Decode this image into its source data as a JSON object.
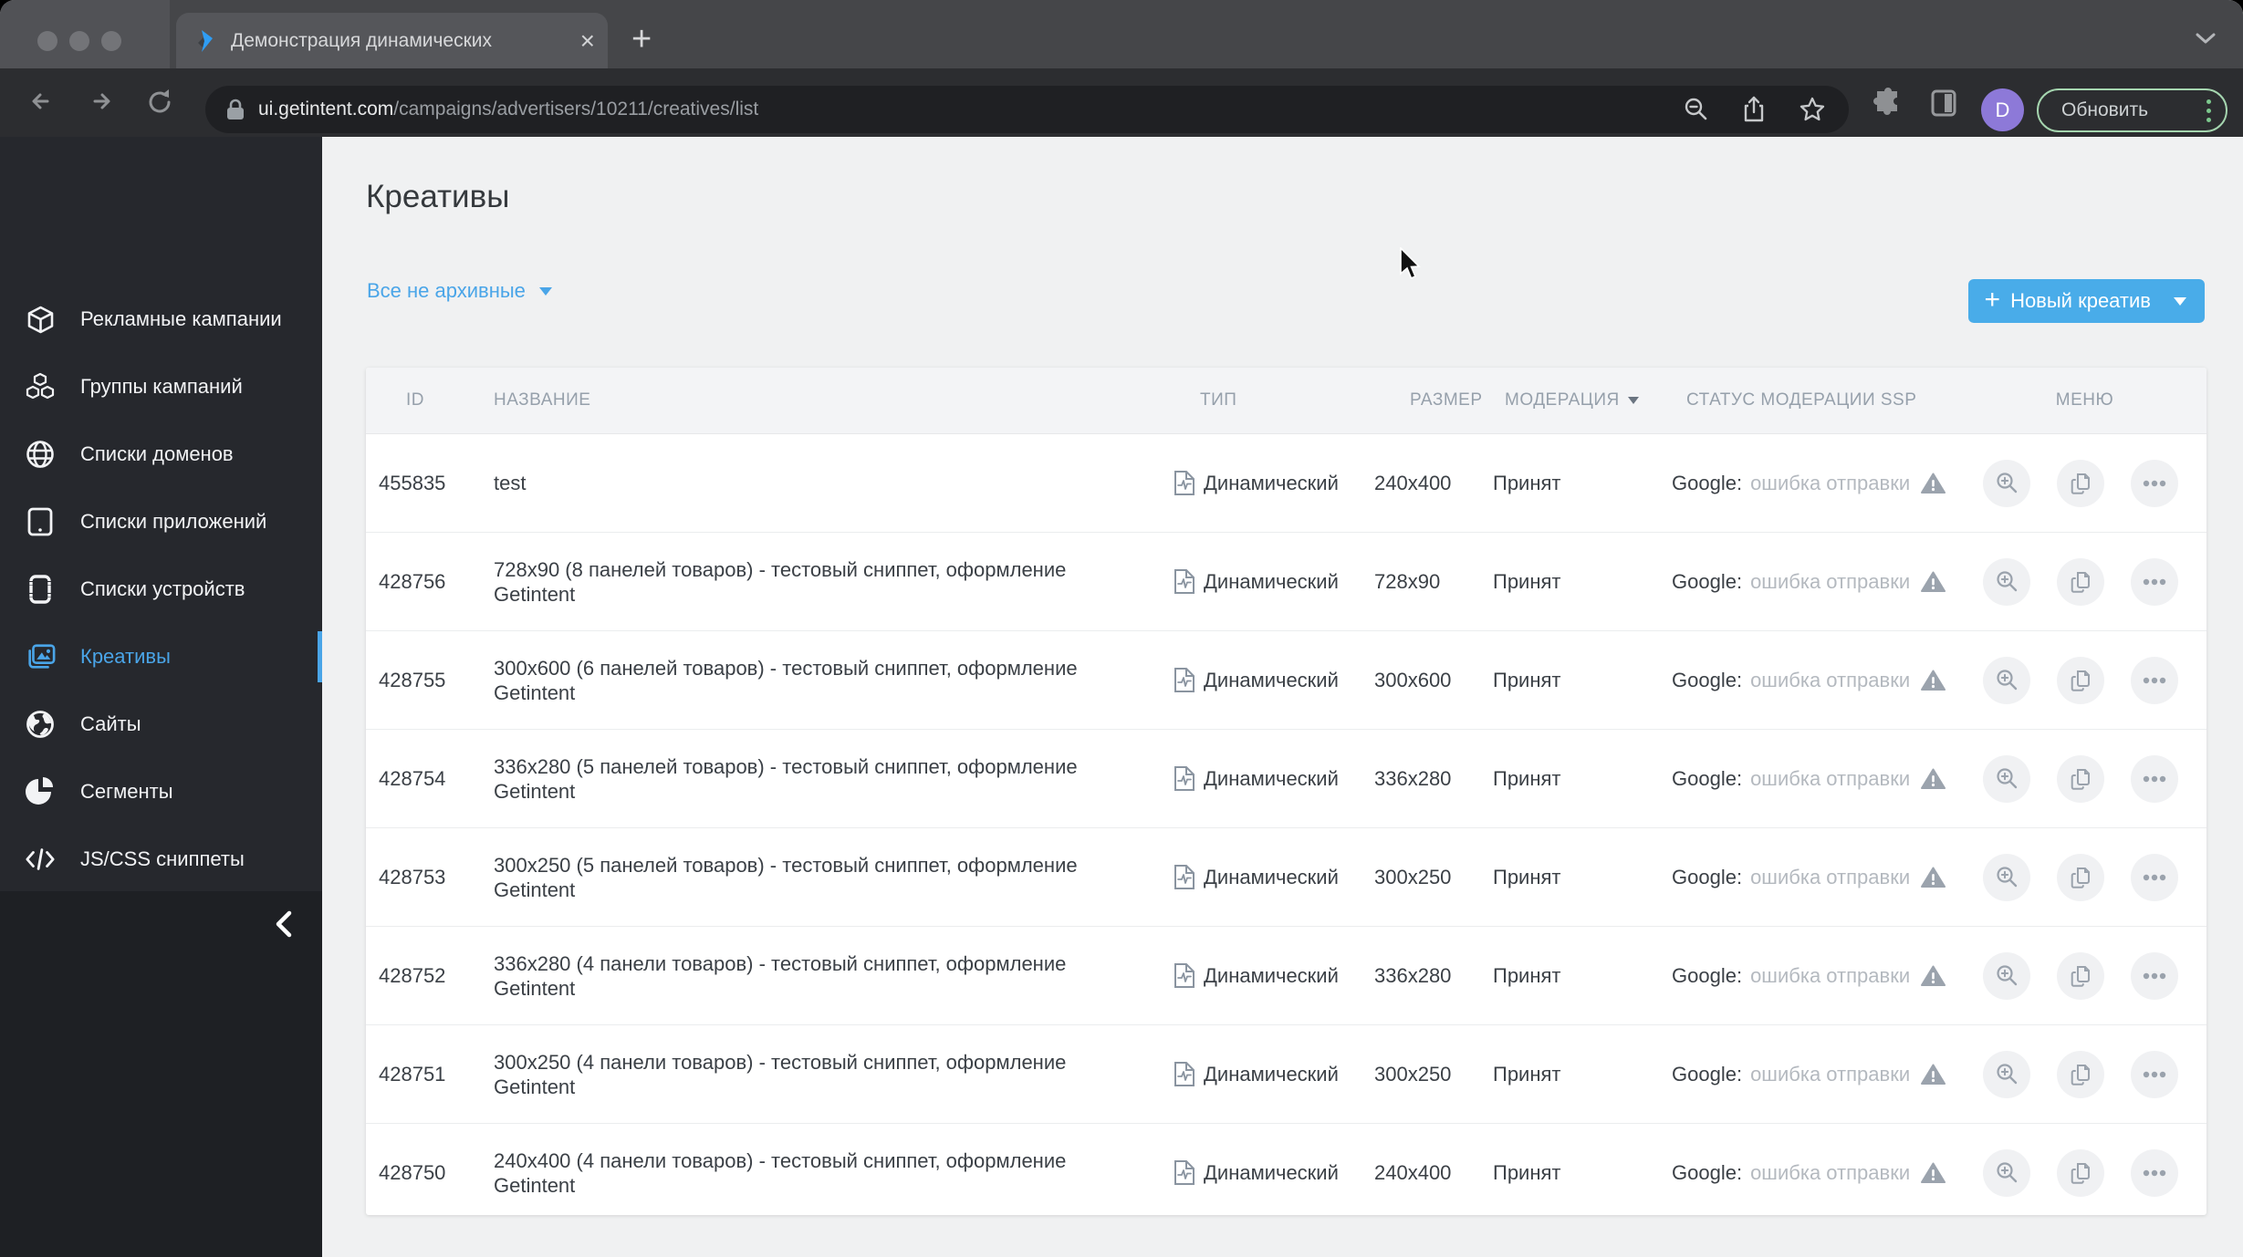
{
  "browser": {
    "tab": {
      "title": "Демонстрация динамических",
      "close_glyph": "×",
      "new_tab_glyph": "+"
    },
    "toolbar": {
      "url_host": "ui.getintent.com",
      "url_path": "/campaigns/advertisers/10211/creatives/list",
      "avatar_letter": "D",
      "update_button_label": "Обновить"
    }
  },
  "sidebar": {
    "items": [
      {
        "label": "Рекламные кампании",
        "icon": "cube-icon"
      },
      {
        "label": "Группы кампаний",
        "icon": "cubes-icon"
      },
      {
        "label": "Списки доменов",
        "icon": "globe-grid-icon"
      },
      {
        "label": "Списки приложений",
        "icon": "tablet-icon"
      },
      {
        "label": "Списки устройств",
        "icon": "device-icon"
      },
      {
        "label": "Креативы",
        "icon": "images-icon",
        "active": true
      },
      {
        "label": "Сайты",
        "icon": "earth-icon"
      },
      {
        "label": "Сегменты",
        "icon": "pie-chart-icon"
      },
      {
        "label": "JS/CSS сниппеты",
        "icon": "code-icon"
      }
    ]
  },
  "main": {
    "page_title": "Креативы",
    "filter_label": "Все не архивные",
    "new_creative_label": "Новый креатив",
    "new_creative_plus": "+",
    "table": {
      "headers": [
        "ID",
        "НАЗВАНИЕ",
        "ТИП",
        "РАЗМЕР",
        "МОДЕРАЦИЯ",
        "СТАТУС МОДЕРАЦИИ SSP",
        "МЕНЮ"
      ],
      "rows": [
        {
          "id": "455835",
          "name": "test",
          "type": "Динамический",
          "size": "240x400",
          "moderation": "Принят",
          "ssp_label": "Google:",
          "ssp_status": "ошибка отправки"
        },
        {
          "id": "428756",
          "name": "728x90 (8 панелей товаров) - тестовый сниппет, оформление Getintent",
          "type": "Динамический",
          "size": "728x90",
          "moderation": "Принят",
          "ssp_label": "Google:",
          "ssp_status": "ошибка отправки"
        },
        {
          "id": "428755",
          "name": "300x600 (6 панелей товаров) - тестовый сниппет, оформление Getintent",
          "type": "Динамический",
          "size": "300x600",
          "moderation": "Принят",
          "ssp_label": "Google:",
          "ssp_status": "ошибка отправки"
        },
        {
          "id": "428754",
          "name": "336x280 (5 панелей товаров) - тестовый сниппет, оформление Getintent",
          "type": "Динамический",
          "size": "336x280",
          "moderation": "Принят",
          "ssp_label": "Google:",
          "ssp_status": "ошибка отправки"
        },
        {
          "id": "428753",
          "name": "300x250 (5 панелей товаров) - тестовый сниппет, оформление Getintent",
          "type": "Динамический",
          "size": "300x250",
          "moderation": "Принят",
          "ssp_label": "Google:",
          "ssp_status": "ошибка отправки"
        },
        {
          "id": "428752",
          "name": "336x280 (4 панели товаров) - тестовый сниппет, оформление Getintent",
          "type": "Динамический",
          "size": "336x280",
          "moderation": "Принят",
          "ssp_label": "Google:",
          "ssp_status": "ошибка отправки"
        },
        {
          "id": "428751",
          "name": "300x250 (4 панели товаров) - тестовый сниппет, оформление Getintent",
          "type": "Динамический",
          "size": "300x250",
          "moderation": "Принят",
          "ssp_label": "Google:",
          "ssp_status": "ошибка отправки"
        },
        {
          "id": "428750",
          "name": "240x400 (4 панели товаров) - тестовый сниппет, оформление Getintent",
          "type": "Динамический",
          "size": "240x400",
          "moderation": "Принят",
          "ssp_label": "Google:",
          "ssp_status": "ошибка отправки"
        }
      ]
    }
  },
  "colors": {
    "accent_blue": "#4aa5e8",
    "button_blue": "#49ace9",
    "update_green": "#a5d5af",
    "avatar_purple": "#8d79d8",
    "sidebar_bg": "#26282d",
    "toolbar_bg": "#2c2d30"
  }
}
